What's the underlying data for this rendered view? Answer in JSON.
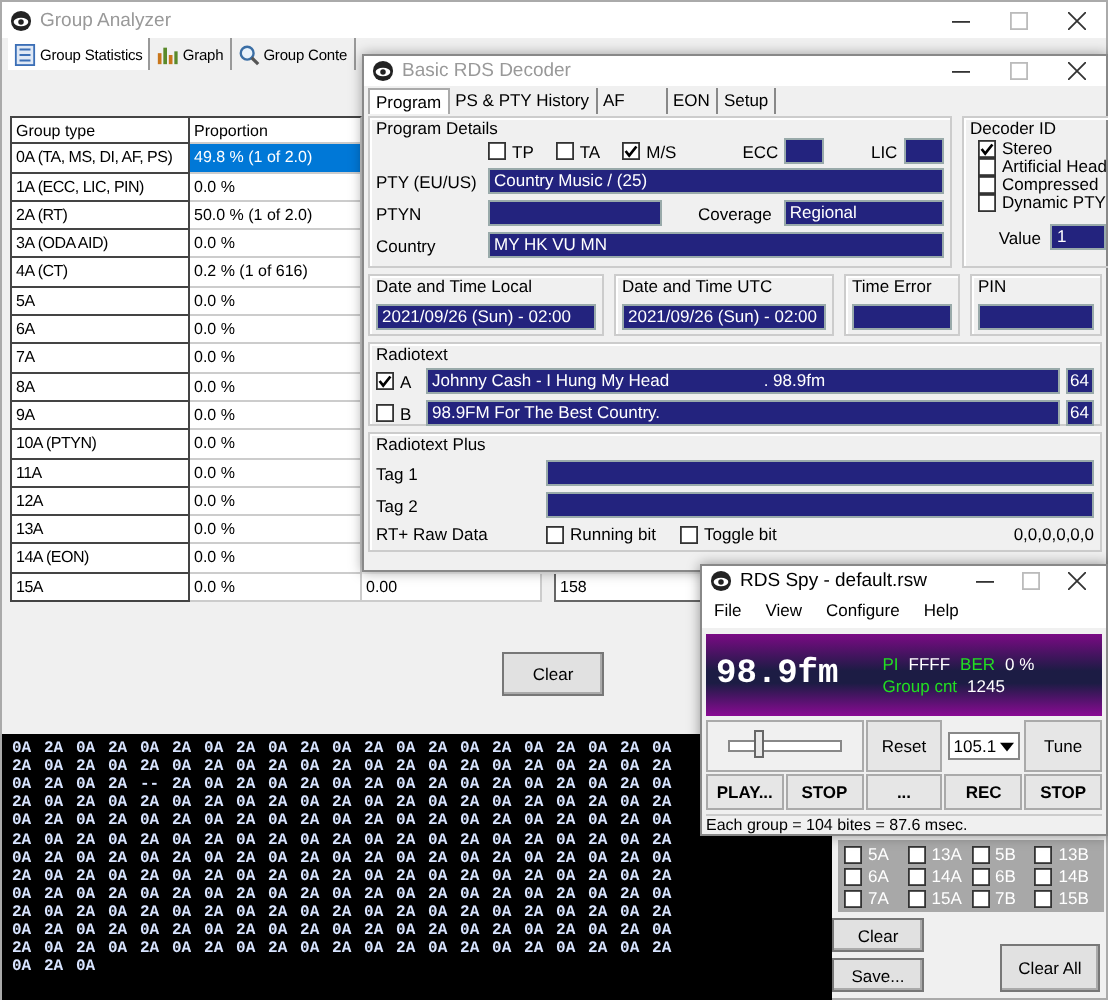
{
  "group_analyzer": {
    "title": "Group Analyzer",
    "tabs": [
      {
        "label": "Group Statistics",
        "selected": true
      },
      {
        "label": "Graph",
        "selected": false
      },
      {
        "label": "Group Conte",
        "selected": false
      }
    ],
    "table": {
      "columns": [
        "Group type",
        "Proportion"
      ],
      "rows": [
        {
          "group_type": "0A (TA, MS, DI, AF, PS)",
          "proportion": "49.8 %  (1 of 2.0)",
          "selected": true
        },
        {
          "group_type": "1A (ECC, LIC, PIN)",
          "proportion": "0.0 %",
          "selected": false
        },
        {
          "group_type": "2A (RT)",
          "proportion": "50.0 %  (1 of 2.0)",
          "selected": false
        },
        {
          "group_type": "3A (ODA AID)",
          "proportion": "0.0 %",
          "selected": false
        },
        {
          "group_type": "4A (CT)",
          "proportion": "0.2 %  (1 of 616)",
          "selected": false
        },
        {
          "group_type": "5A",
          "proportion": "0.0 %",
          "selected": false
        },
        {
          "group_type": "6A",
          "proportion": "0.0 %",
          "selected": false
        },
        {
          "group_type": "7A",
          "proportion": "0.0 %",
          "selected": false
        },
        {
          "group_type": "8A",
          "proportion": "0.0 %",
          "selected": false
        },
        {
          "group_type": "9A",
          "proportion": "0.0 %",
          "selected": false
        },
        {
          "group_type": "10A (PTYN)",
          "proportion": "0.0 %",
          "selected": false
        },
        {
          "group_type": "11A",
          "proportion": "0.0 %",
          "selected": false
        },
        {
          "group_type": "12A",
          "proportion": "0.0 %",
          "selected": false
        },
        {
          "group_type": "13A",
          "proportion": "0.0 %",
          "selected": false
        },
        {
          "group_type": "14A (EON)",
          "proportion": "0.0 %",
          "selected": false
        },
        {
          "group_type": "15A",
          "proportion": "0.0 %",
          "column_3": "0.00",
          "column_4": "158",
          "selected": false
        }
      ]
    },
    "clear_button": "Clear",
    "stream": [
      "0A 2A 0A 2A 0A 2A 0A 2A 0A 2A 0A 2A 0A 2A 0A 2A 0A 2A 0A 2A 0A",
      "2A 0A 2A 0A 2A 0A 2A 0A 2A 0A 2A 0A 2A 0A 2A 0A 2A 0A 2A 0A 2A",
      "0A 2A 0A 2A -- 2A 0A 2A 0A 2A 0A 2A 0A 2A 0A 2A 0A 2A 0A 2A 0A",
      "2A 0A 2A 0A 2A 0A 2A 0A 2A 0A 2A 0A 2A 0A 2A 0A 2A 0A 2A 0A 2A",
      "0A 2A 0A 2A 0A 2A 0A 2A 0A 2A 0A 2A 0A 2A 0A 2A 0A 2A 0A 2A 0A",
      "2A 0A 2A 0A 2A 0A 2A 0A 2A 0A 2A 0A 2A 0A 2A 0A 2A 0A 2A 0A 2A",
      "0A 2A 0A 2A 0A 2A 0A 2A 0A 2A 0A 2A 0A 2A 0A 2A 0A 2A 0A 2A 0A",
      "2A 0A 2A 0A 2A 0A 2A 0A 2A 0A 2A 0A 2A 0A 2A 0A 2A 0A 2A 0A 2A",
      "0A 2A 0A 2A 0A 2A 0A 2A 0A 2A 0A 2A 0A 2A 0A 2A 0A 2A 0A 2A 0A",
      "2A 0A 2A 0A 2A 0A 2A 0A 2A 0A 2A 0A 2A 0A 2A 0A 2A 0A 2A 0A 2A",
      "0A 2A 0A 2A 0A 2A 0A 2A 0A 2A 0A 2A 0A 2A 0A 2A 0A 2A 0A 2A 0A",
      "2A 0A 2A 0A 2A 0A 2A 0A 2A 0A 2A 0A 2A 0A 2A 0A 2A 0A 2A 0A 2A",
      "0A 2A 0A"
    ],
    "group_filter": [
      {
        "label": "5A",
        "checked": false
      },
      {
        "label": "13A",
        "checked": false
      },
      {
        "label": "5B",
        "checked": false
      },
      {
        "label": "13B",
        "checked": false
      },
      {
        "label": "6A",
        "checked": false
      },
      {
        "label": "14A",
        "checked": false
      },
      {
        "label": "6B",
        "checked": false
      },
      {
        "label": "14B",
        "checked": false
      },
      {
        "label": "7A",
        "checked": false
      },
      {
        "label": "15A",
        "checked": false
      },
      {
        "label": "7B",
        "checked": false
      },
      {
        "label": "15B",
        "checked": false
      }
    ],
    "side_buttons": [
      "Clear",
      "Save..."
    ],
    "clear_all_button": "Clear All"
  },
  "rds_decoder": {
    "title": "Basic RDS Decoder",
    "tabs": [
      {
        "label": "Program",
        "selected": true
      },
      {
        "label": "PS & PTY History",
        "selected": false
      },
      {
        "label": "AF",
        "selected": false
      },
      {
        "label": "EON",
        "selected": false
      },
      {
        "label": "Setup",
        "selected": false
      }
    ],
    "program_details": {
      "title": "Program Details",
      "flags": [
        {
          "label": "TP",
          "checked": false
        },
        {
          "label": "TA",
          "checked": false
        },
        {
          "label": "M/S",
          "checked": true
        }
      ],
      "ecc_label": "ECC",
      "lic_label": "LIC",
      "pty_label": "PTY (EU/US)",
      "pty": "Country Music /  (25)",
      "ptyn_label": "PTYN",
      "coverage_label": "Coverage",
      "coverage": "Regional",
      "country_label": "Country",
      "country": "MY HK VU MN"
    },
    "decoder_id": {
      "title": "Decoder ID",
      "flags": [
        {
          "label": "Stereo",
          "checked": true
        },
        {
          "label": "Artificial Head",
          "checked": false
        },
        {
          "label": "Compressed",
          "checked": false
        },
        {
          "label": "Dynamic PTY",
          "checked": false
        }
      ],
      "value_label": "Value",
      "value": "1"
    },
    "time_boxes": [
      {
        "title": "Date and Time Local",
        "value": "2021/09/26 (Sun) - 02:00"
      },
      {
        "title": "Date and Time UTC",
        "value": "2021/09/26 (Sun) - 02:00"
      },
      {
        "title": "Time Error"
      },
      {
        "title": "PIN"
      }
    ],
    "radiotext": {
      "title": "Radiotext",
      "lines": [
        {
          "label": "A",
          "checked": true,
          "text": "Johnny Cash - I Hung My Head                    . 98.9fm",
          "count": "64"
        },
        {
          "label": "B",
          "checked": false,
          "text": "98.9FM For The Best Country.",
          "count": "64"
        }
      ]
    },
    "radiotext_plus": {
      "title": "Radiotext Plus",
      "tags": [
        "Tag 1",
        "Tag 2"
      ],
      "raw_label": "RT+ Raw Data",
      "flags": [
        {
          "label": "Running bit",
          "checked": false
        },
        {
          "label": "Toggle bit",
          "checked": false
        }
      ],
      "raw_value": "0,0,0,0,0,0"
    }
  },
  "rds_spy": {
    "title": "RDS Spy - default.rsw",
    "menu": [
      "File",
      "View",
      "Configure",
      "Help"
    ],
    "ps": "98.9fm",
    "pi_label": "PI",
    "pi": "FFFF",
    "ber_label": "BER",
    "ber": "0 %",
    "group_count_label": "Group cnt",
    "group_count": "1245",
    "slider": {
      "level": 0.25
    },
    "reset": "Reset",
    "frequency": "105.1",
    "tune": "Tune",
    "buttons": [
      "PLAY...",
      "STOP",
      "...",
      "REC",
      "STOP"
    ],
    "status": "Each group = 104 bites = 87.6 msec."
  }
}
